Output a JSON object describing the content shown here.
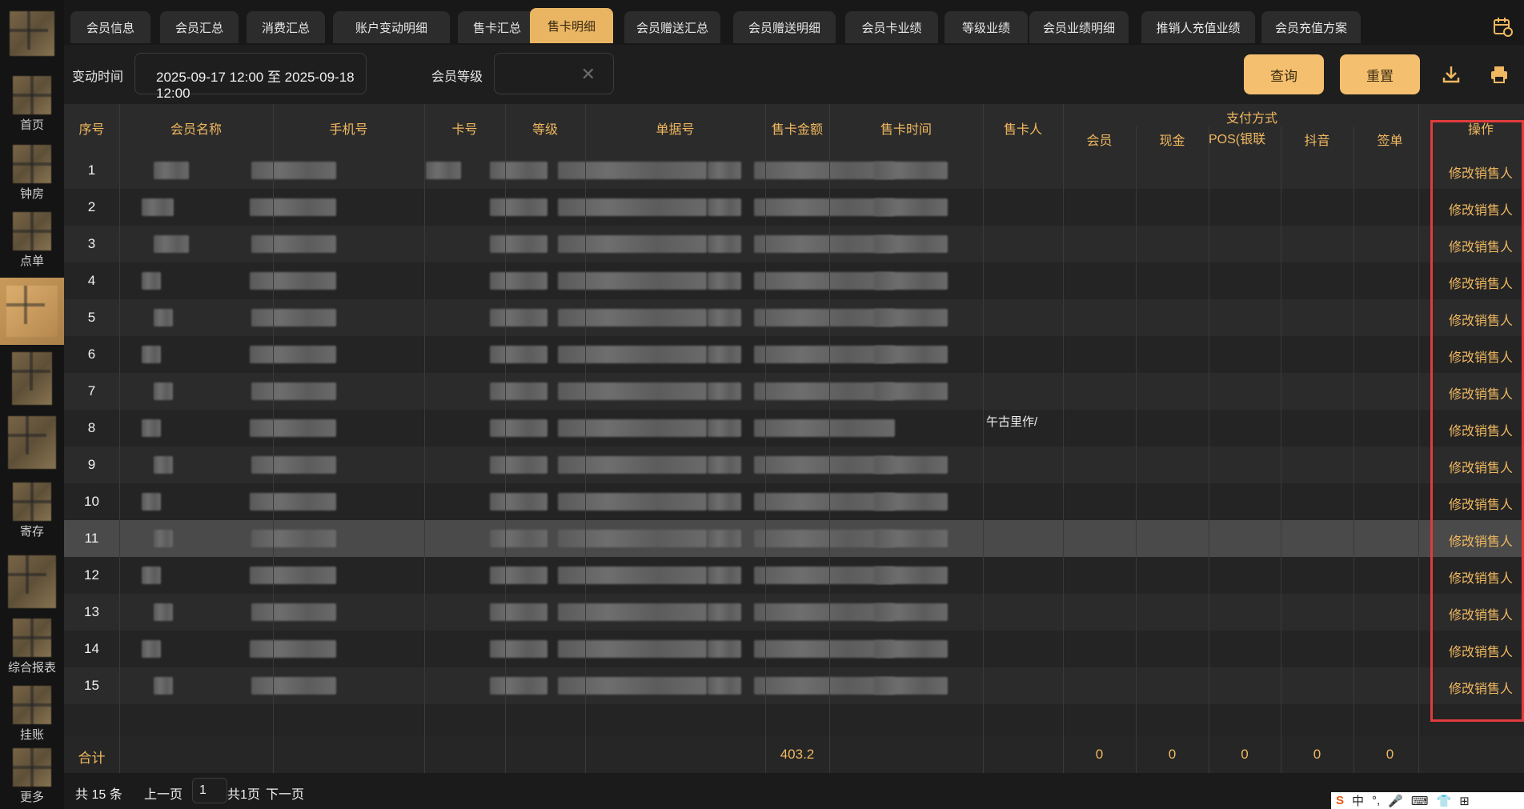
{
  "sidebar": {
    "items": [
      {
        "label": ""
      },
      {
        "label": "首页"
      },
      {
        "label": "钟房"
      },
      {
        "label": "点单"
      },
      {
        "label": ""
      },
      {
        "label": ""
      },
      {
        "label": ""
      },
      {
        "label": "寄存"
      },
      {
        "label": ""
      },
      {
        "label": "综合报表"
      },
      {
        "label": "挂账"
      },
      {
        "label": "更多"
      }
    ]
  },
  "tabs": [
    "会员信息",
    "会员汇总",
    "消费汇总",
    "账户变动明细",
    "售卡汇总",
    "售卡明细",
    "会员赠送汇总",
    "会员赠送明细",
    "会员卡业绩",
    "等级业绩",
    "会员业绩明细",
    "推销人充值业绩",
    "会员充值方案"
  ],
  "active_tab": "售卡明细",
  "filters": {
    "time_label": "变动时间",
    "time_value": "2025-09-17 12:00 至 2025-09-18 12:00",
    "level_label": "会员等级",
    "level_value": "",
    "clear_icon": "close-icon",
    "query_label": "查询",
    "reset_label": "重置"
  },
  "table": {
    "headers": {
      "idx": "序号",
      "name": "会员名称",
      "phone": "手机号",
      "card": "卡号",
      "level": "等级",
      "bill": "单据号",
      "amount": "售卡金额",
      "time": "售卡时间",
      "seller": "售卡人",
      "pay_group": "支付方式",
      "pay_member": "会员",
      "pay_cash": "现金",
      "pay_pos": "POS(银联卡)",
      "pay_douyin": "抖音",
      "pay_sign": "签单",
      "action": "操作"
    },
    "rows": [
      {
        "idx": "1",
        "action": "修改销售人"
      },
      {
        "idx": "2",
        "action": "修改销售人"
      },
      {
        "idx": "3",
        "action": "修改销售人"
      },
      {
        "idx": "4",
        "action": "修改销售人"
      },
      {
        "idx": "5",
        "action": "修改销售人"
      },
      {
        "idx": "6",
        "action": "修改销售人"
      },
      {
        "idx": "7",
        "action": "修改销售人"
      },
      {
        "idx": "8",
        "action": "修改销售人",
        "seller_partial": "午古里作/"
      },
      {
        "idx": "9",
        "action": "修改销售人"
      },
      {
        "idx": "10",
        "action": "修改销售人"
      },
      {
        "idx": "11",
        "action": "修改销售人"
      },
      {
        "idx": "12",
        "action": "修改销售人"
      },
      {
        "idx": "13",
        "action": "修改销售人"
      },
      {
        "idx": "14",
        "action": "修改销售人"
      },
      {
        "idx": "15",
        "action": "修改销售人"
      }
    ],
    "totals": {
      "label": "合计",
      "amount": "403.2",
      "pay_member": "0",
      "pay_cash": "0",
      "pay_pos": "0",
      "pay_douyin": "0",
      "pay_sign": "0"
    }
  },
  "pager": {
    "total": "共 15 条",
    "prev": "上一页",
    "page": "1",
    "pages": "共1页",
    "next": "下一页"
  },
  "ime": {
    "mode": "中"
  },
  "colors": {
    "accent": "#f4c06f",
    "link": "#f0b860",
    "highlight_box": "#e23b3b"
  }
}
